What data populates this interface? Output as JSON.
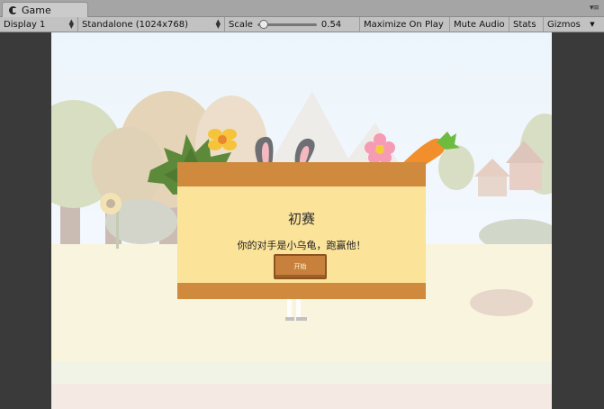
{
  "window": {
    "tab_label": "Game"
  },
  "toolbar": {
    "display": "Display 1",
    "resolution": "Standalone (1024x768)",
    "scale_label": "Scale",
    "scale_value": "0.54",
    "scale_fraction": 0.04,
    "maximize_on_play": "Maximize On Play",
    "mute_audio": "Mute Audio",
    "stats": "Stats",
    "gizmos": "Gizmos"
  },
  "dialog": {
    "title": "初赛",
    "message": "你的对手是小乌龟，跑赢他！",
    "start_button": "开始"
  },
  "colors": {
    "dialog_frame": "#d08a3e",
    "dialog_body": "#fce39a",
    "sky": "#e2eef9"
  }
}
